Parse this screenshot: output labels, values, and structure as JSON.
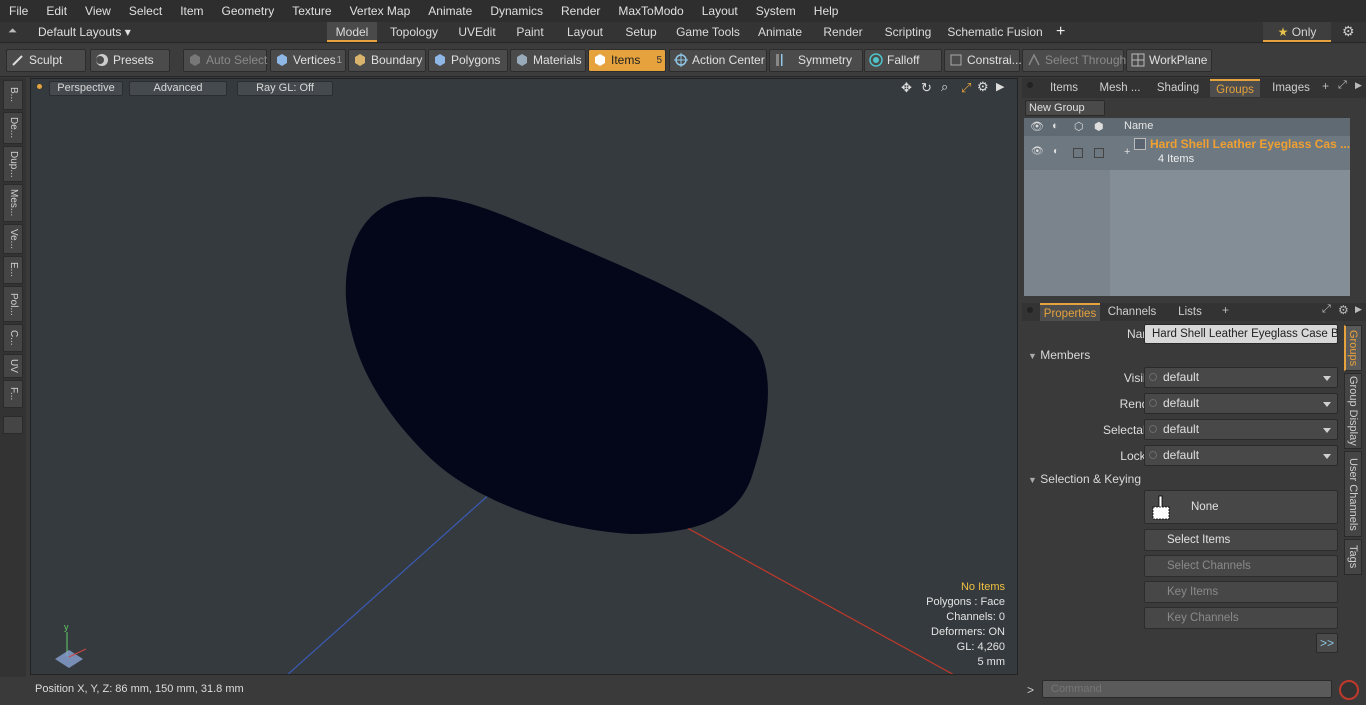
{
  "menu": [
    "File",
    "Edit",
    "View",
    "Select",
    "Item",
    "Geometry",
    "Texture",
    "Vertex Map",
    "Animate",
    "Dynamics",
    "Render",
    "MaxToModo",
    "Layout",
    "System",
    "Help"
  ],
  "layout_selector": "Default Layouts",
  "layout_tabs": [
    "Model",
    "Topology",
    "UVEdit",
    "Paint",
    "Layout",
    "Setup",
    "Game Tools",
    "Animate",
    "Render",
    "Scripting",
    "Schematic Fusion"
  ],
  "active_layout_tab": "Model",
  "only_label": "Only",
  "toolbar": {
    "sculpt": "Sculpt",
    "presets": "Presets",
    "auto_select": "Auto Select",
    "vertices": "Vertices",
    "vertices_count": "1",
    "boundary": "Boundary",
    "polygons": "Polygons",
    "materials": "Materials",
    "items": "Items",
    "items_count": "5",
    "action_center": "Action Center",
    "symmetry": "Symmetry",
    "falloff": "Falloff",
    "constraints": "Constrai...",
    "select_through": "Select Through",
    "workplane": "WorkPlane"
  },
  "left_tabs": [
    "B...",
    "De...",
    "Dup...",
    "Mes...",
    "Ve...",
    "E...",
    "Pol...",
    "C...",
    "UV",
    "F..."
  ],
  "viewport": {
    "view": "Perspective",
    "style": "Advanced",
    "raygl": "Ray GL: Off",
    "stats": {
      "items": "No Items",
      "polygons": "Polygons : Face",
      "channels": "Channels: 0",
      "deformers": "Deformers: ON",
      "gl": "GL: 4,260",
      "scale": "5 mm"
    }
  },
  "status": {
    "position": "Position X, Y, Z:  86 mm, 150 mm, 31.8 mm"
  },
  "groups_panel": {
    "tabs": [
      "Items",
      "Mesh ...",
      "Shading",
      "Groups",
      "Images"
    ],
    "active_tab": "Groups",
    "new_group": "New Group",
    "column_name": "Name",
    "group_name": "Hard Shell Leather Eyeglass Cas ...",
    "group_count": "4 Items"
  },
  "properties_panel": {
    "tabs": [
      "Properties",
      "Channels",
      "Lists"
    ],
    "active_tab": "Properties",
    "name_label": "Name",
    "name_value": "Hard Shell Leather Eyeglass Case Blac",
    "members_header": "Members",
    "visible_label": "Visible",
    "visible_value": "default",
    "render_label": "Render",
    "render_value": "default",
    "selectable_label": "Selectable",
    "selectable_value": "default",
    "locked_label": "Locked",
    "locked_value": "default",
    "selection_header": "Selection & Keying",
    "none_button": "None",
    "select_items": "Select Items",
    "select_channels": "Select Channels",
    "key_items": "Key Items",
    "key_channels": "Key Channels",
    "more_button": ">>",
    "side_tabs": [
      "Groups",
      "Group Display",
      "User Channels",
      "Tags"
    ]
  },
  "command": {
    "prompt": ">",
    "placeholder": "Command"
  },
  "colors": {
    "accent": "#e6a23c",
    "mesh": "#04061a",
    "viewport_bg": "#343a3e"
  }
}
